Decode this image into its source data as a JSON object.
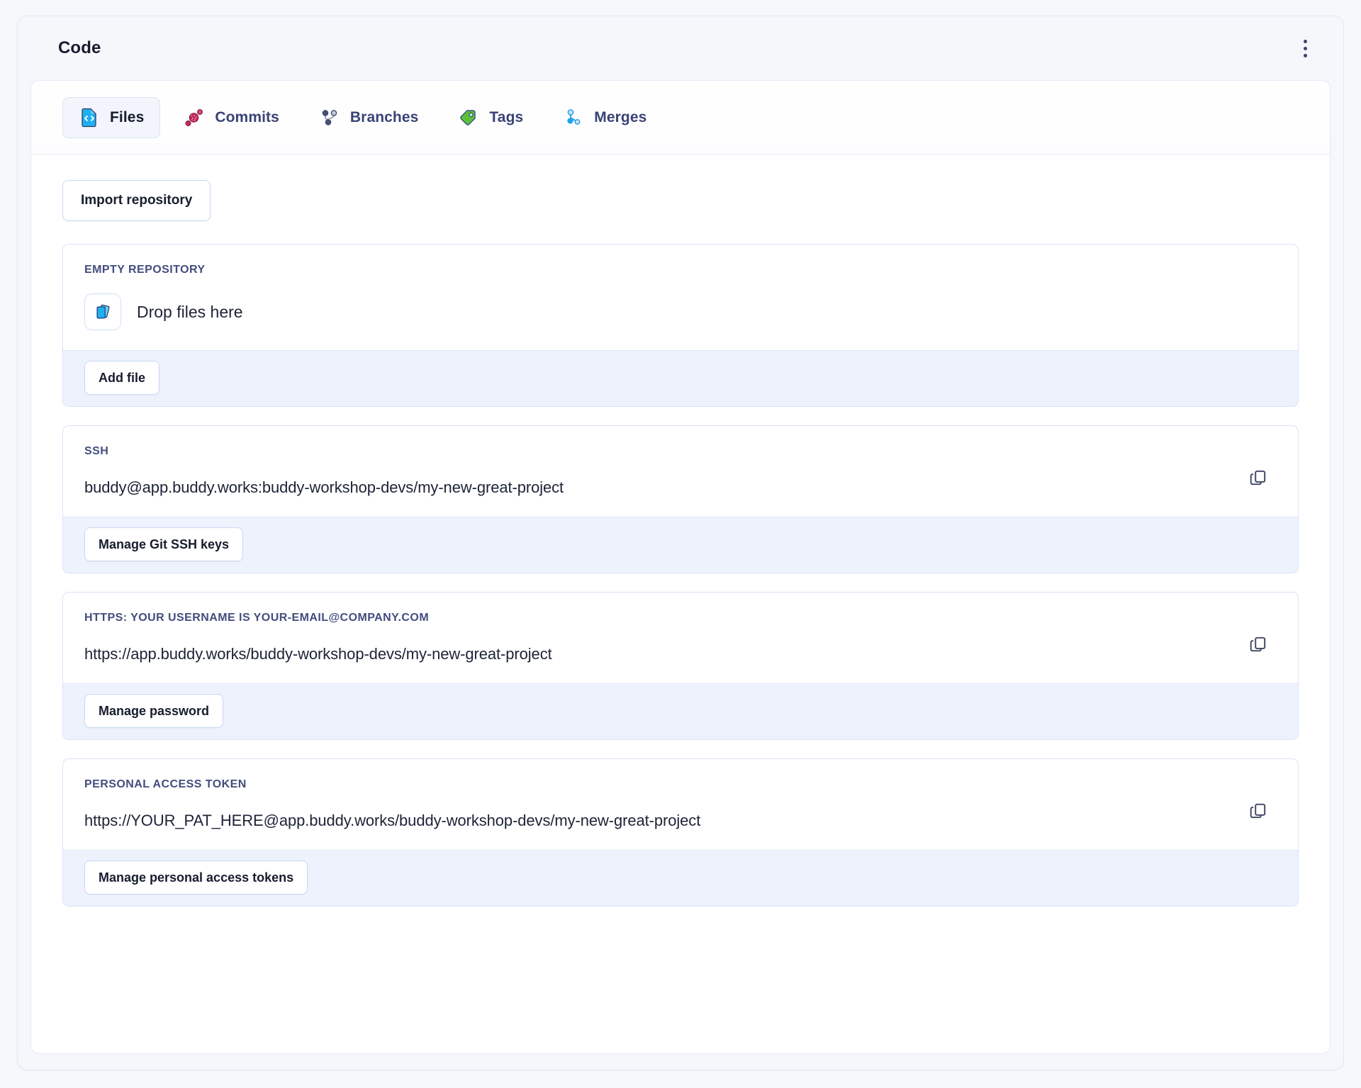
{
  "window": {
    "title": "Code",
    "menu_icon": "kebab-menu-icon"
  },
  "tabs": [
    {
      "id": "files",
      "label": "Files",
      "icon": "file-code-icon",
      "active": true
    },
    {
      "id": "commits",
      "label": "Commits",
      "icon": "commits-icon",
      "active": false
    },
    {
      "id": "branches",
      "label": "Branches",
      "icon": "branches-icon",
      "active": false
    },
    {
      "id": "tags",
      "label": "Tags",
      "icon": "tag-icon",
      "active": false
    },
    {
      "id": "merges",
      "label": "Merges",
      "icon": "merge-icon",
      "active": false
    }
  ],
  "toolbar": {
    "import_label": "Import repository"
  },
  "panels": {
    "empty_repository": {
      "label": "EMPTY REPOSITORY",
      "drop_text": "Drop files here",
      "drop_icon": "files-stack-icon",
      "button_label": "Add file"
    },
    "ssh": {
      "label": "SSH",
      "value": "buddy@app.buddy.works:buddy-workshop-devs/my-new-great-project",
      "copy_icon": "copy-icon",
      "button_label": "Manage Git SSH keys"
    },
    "https": {
      "label": "HTTPS: YOUR USERNAME IS YOUR-EMAIL@COMPANY.COM",
      "value": "https://app.buddy.works/buddy-workshop-devs/my-new-great-project",
      "copy_icon": "copy-icon",
      "button_label": "Manage password"
    },
    "personal_access_token": {
      "label": "PERSONAL ACCESS TOKEN",
      "value": "https://YOUR_PAT_HERE@app.buddy.works/buddy-workshop-devs/my-new-great-project",
      "copy_icon": "copy-icon",
      "button_label": "Manage personal access tokens"
    }
  },
  "colors": {
    "page_background": "#f7f8fc",
    "card_background": "#f5f7fb",
    "panel_border": "#d9e3f5",
    "footer_background": "#eef2fd",
    "accent_blue": "#22a8f0",
    "commit_red": "#c22a5a",
    "tag_green": "#5cc138",
    "branch_navy": "#3a4375",
    "text_dark": "#171c2e"
  }
}
